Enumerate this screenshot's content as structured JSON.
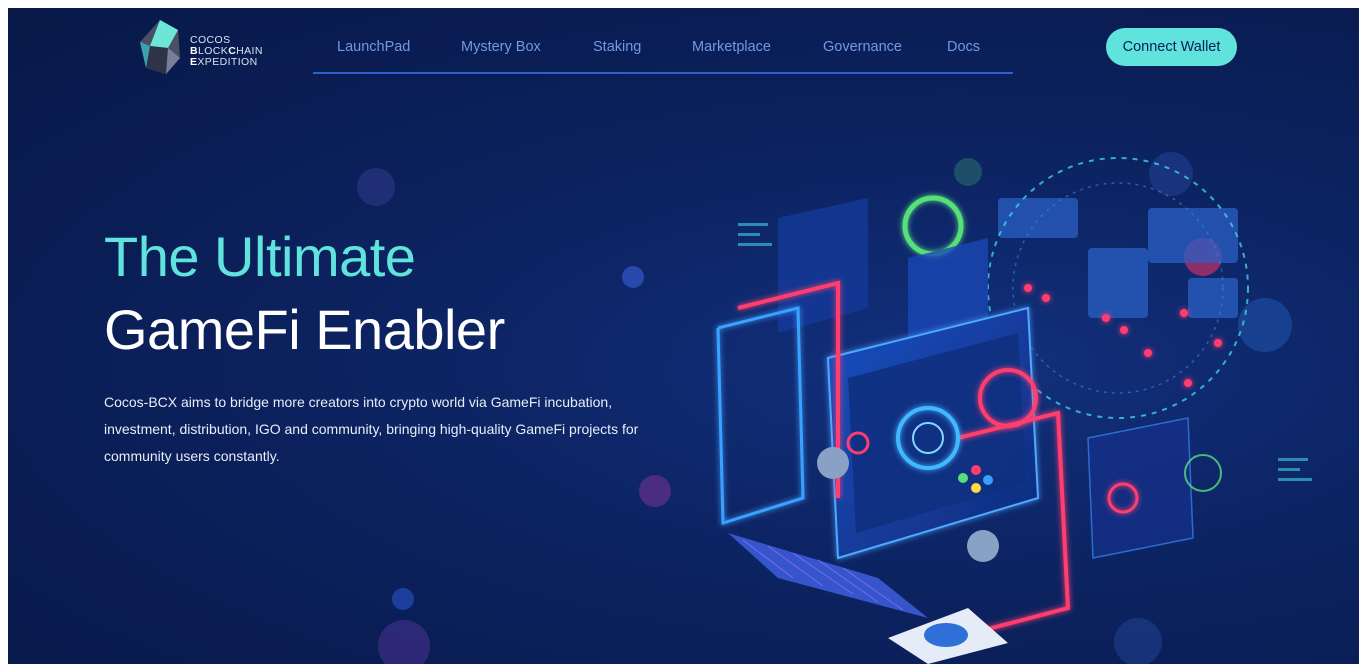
{
  "brand": {
    "logo_icon": "cocos-crystal-logo-icon",
    "line1": "COCOS",
    "line2_bold_1": "B",
    "line2_rest_1": "LOCK",
    "line2_bold_2": "C",
    "line2_rest_2": "HAIN",
    "line3_bold": "E",
    "line3_rest": "XPEDITION"
  },
  "nav": {
    "items": [
      {
        "label": "LaunchPad"
      },
      {
        "label": "Mystery Box"
      },
      {
        "label": "Staking"
      },
      {
        "label": "Marketplace"
      },
      {
        "label": "Governance"
      },
      {
        "label": "Docs"
      }
    ],
    "connect_label": "Connect Wallet"
  },
  "hero": {
    "title_line1": "The Ultimate",
    "title_line2": "GameFi Enabler",
    "description": "Cocos-BCX aims to bridge more creators into crypto world via GameFi incubation, investment, distribution, IGO and community, bringing high-quality GameFi projects for community users constantly.",
    "illustration_icon": "isometric-computer-gaming-illustration"
  },
  "colors": {
    "background": "#0a1d54",
    "accent_cyan": "#5fe3dc",
    "nav_text": "#6f9ae6",
    "nav_underline": "#2a62c9",
    "neon_red": "#ff3c6e",
    "neon_blue": "#3aa0ff"
  }
}
